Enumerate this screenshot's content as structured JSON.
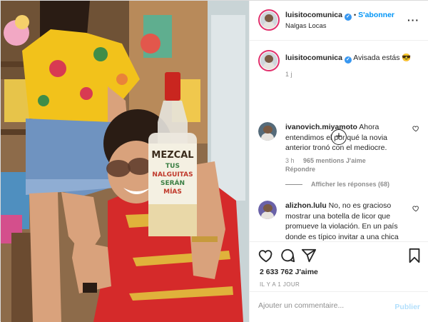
{
  "post": {
    "author": {
      "username": "luisitocomunica",
      "verified_icon": "verified-badge-icon",
      "follow_label": "S'abonner",
      "location": "Nalgas Locas"
    },
    "caption": {
      "username": "luisitocomunica",
      "text": "Avisada estás",
      "emoji": "😎",
      "time": "1 j"
    },
    "comments": [
      {
        "username": "ivanovich.miyamoto",
        "text": "Ahora entendimos el por qué la novia anterior tronó con el mediocre.",
        "time": "3 h",
        "likes": "965 mentions J'aime",
        "reply_label": "Répondre",
        "replies_label": "Afficher les réponses (68)"
      },
      {
        "username": "alizhon.lulu",
        "text": "No, no es gracioso mostrar una botella de licor que promueve la violación. En un país donde es típico invitar a una chica"
      }
    ],
    "likes_count": "2 633 762 J'aime",
    "date": "IL Y A 1 JOUR",
    "comment_placeholder": "Ajouter un commentaire...",
    "publish_label": "Publier"
  },
  "photo": {
    "bottle_label": {
      "line1": "MEZCAL",
      "line2": "TUS",
      "line3": "NALGUITAS",
      "line4": "SERÁN",
      "line5": "MÍAS"
    }
  },
  "icons": [
    "more-options-icon",
    "load-more-icon",
    "heart-icon",
    "comment-icon",
    "share-icon",
    "bookmark-icon"
  ],
  "colors": {
    "accent": "#0095f6",
    "verified": "#3897f0",
    "muted": "#8e8e8e",
    "publish_disabled": "#b2dffc"
  }
}
